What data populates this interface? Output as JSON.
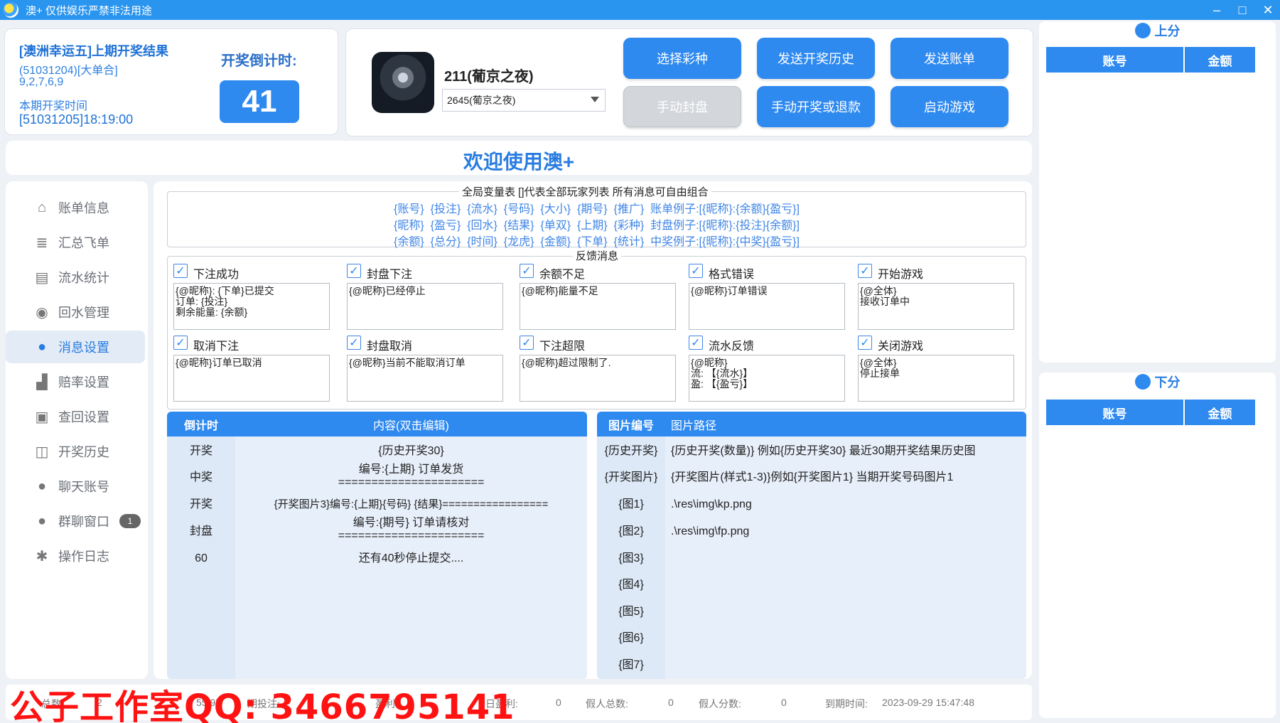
{
  "window": {
    "title": "澳+ 仅供娱乐严禁非法用途",
    "minimize": "–",
    "maximize": "□",
    "close": "✕"
  },
  "info": {
    "line1": "[澳洲幸运五]上期开奖结果",
    "line2": "(51031204)[大单合]",
    "line3": "9,2,7,6,9",
    "line4": "本期开奖时间",
    "line5": "[51031205]18:19:00",
    "countdown_label": "开奖倒计时:",
    "countdown_value": "41"
  },
  "game": {
    "name": "211(葡京之夜)",
    "selected": "2645(葡京之夜)"
  },
  "buttons": {
    "select_lottery": "选择彩种",
    "send_history": "发送开奖历史",
    "send_bill": "发送账单",
    "manual_close": "手动封盘",
    "manual_draw": "手动开奖或退款",
    "start_game": "启动游戏"
  },
  "welcome": "欢迎使用澳+",
  "sidebar": {
    "items": [
      {
        "label": "账单信息",
        "icon": "home-icon"
      },
      {
        "label": "汇总飞单",
        "icon": "coins-icon"
      },
      {
        "label": "流水统计",
        "icon": "list-icon"
      },
      {
        "label": "回水管理",
        "icon": "refresh-icon"
      },
      {
        "label": "消息设置",
        "icon": "chat-icon"
      },
      {
        "label": "赔率设置",
        "icon": "chart-icon"
      },
      {
        "label": "查回设置",
        "icon": "trash-icon"
      },
      {
        "label": "开奖历史",
        "icon": "history-icon"
      },
      {
        "label": "聊天账号",
        "icon": "apple-icon"
      },
      {
        "label": "群聊窗口",
        "icon": "group-chat-icon",
        "badge": "1"
      },
      {
        "label": "操作日志",
        "icon": "bug-icon"
      }
    ]
  },
  "variables": {
    "title": "全局变量表   []代表全部玩家列表  所有消息可自由组合",
    "line1": "{账号}  {投注}  {流水}  {号码}  {大小}  {期号}  {推广}  账单例子:[{昵称}:{余额}{盈亏}]",
    "line2": "{昵称}  {盈亏}  {回水}  {结果}  {单双}  {上期}  {彩种}  封盘例子:[{昵称}:{投注}{余额}]",
    "line3": "{余额}  {总分}  {时间}  {龙虎}  {金额}  {下单}  {统计}  中奖例子:[{昵称}:{中奖}{盈亏}]"
  },
  "feedback": {
    "title": "反馈消息",
    "items": [
      {
        "label": "下注成功",
        "text": "{@昵称}: {下单}已提交\n订单: {投注}\n剩余能量: {余额}"
      },
      {
        "label": "封盘下注",
        "text": "{@昵称}已经停止"
      },
      {
        "label": "余额不足",
        "text": "{@昵称}能量不足"
      },
      {
        "label": "格式错误",
        "text": "{@昵称}订单错误"
      },
      {
        "label": "开始游戏",
        "text": "{@全体}\n接收订单中"
      },
      {
        "label": "取消下注",
        "text": "{@昵称}订单已取消"
      },
      {
        "label": "封盘取消",
        "text": "{@昵称}当前不能取消订单"
      },
      {
        "label": "下注超限",
        "text": "{@昵称}超过限制了."
      },
      {
        "label": "流水反馈",
        "text": "{@昵称}\n流: 【{流水}】\n盈: 【{盈亏}】"
      },
      {
        "label": "关闭游戏",
        "text": "{@全体}\n停止接单"
      }
    ]
  },
  "schedule": {
    "headers": [
      "倒计时",
      "内容(双击编辑)"
    ],
    "rows": [
      {
        "time": "开奖",
        "content": "{历史开奖30}"
      },
      {
        "time": "中奖",
        "content": "编号:{上期} 订单发货\n======================"
      },
      {
        "time": "开奖",
        "content": "{开奖图片3}编号:{上期}{号码} {结果}================="
      },
      {
        "time": "封盘",
        "content": "编号:{期号} 订单请核对\n======================"
      },
      {
        "time": "60",
        "content": "还有40秒停止提交...."
      }
    ]
  },
  "images": {
    "headers": [
      "图片编号",
      "图片路径"
    ],
    "rows": [
      {
        "id": "{历史开奖}",
        "path": "{历史开奖(数量)} 例如{历史开奖30} 最近30期开奖结果历史图"
      },
      {
        "id": "{开奖图片}",
        "path": "{开奖图片(样式1-3)}例如{开奖图片1} 当期开奖号码图片1"
      },
      {
        "id": "{图1}",
        "path": ".\\res\\img\\kp.png"
      },
      {
        "id": "{图2}",
        "path": ".\\res\\img\\fp.png"
      },
      {
        "id": "{图3}",
        "path": ""
      },
      {
        "id": "{图4}",
        "path": ""
      },
      {
        "id": "{图5}",
        "path": ""
      },
      {
        "id": "{图6}",
        "path": ""
      },
      {
        "id": "{图7}",
        "path": ""
      }
    ]
  },
  "up_panel": {
    "title": "上分",
    "col_account": "账号",
    "col_amount": "金额"
  },
  "down_panel": {
    "title": "下分",
    "col_account": "账号",
    "col_amount": "金额"
  },
  "status": {
    "total_label": "总数",
    "total_value": "2",
    "item2": "55.95",
    "item3": "期投注:",
    "item4": "盈利:",
    "today_profit_label": "日盈利:",
    "today_profit_value": "0",
    "fake_total_label": "假人总数:",
    "fake_total_value": "0",
    "fake_score_label": "假人分数:",
    "fake_score_value": "0",
    "expire_label": "到期时间:",
    "expire_value": "2023-09-29 15:47:48"
  },
  "watermark": "公子工作室QQ: 3466795141",
  "colors": {
    "accent": "#2f8af0",
    "titlebar": "#2a95ee",
    "watermark": "#ff1212"
  }
}
